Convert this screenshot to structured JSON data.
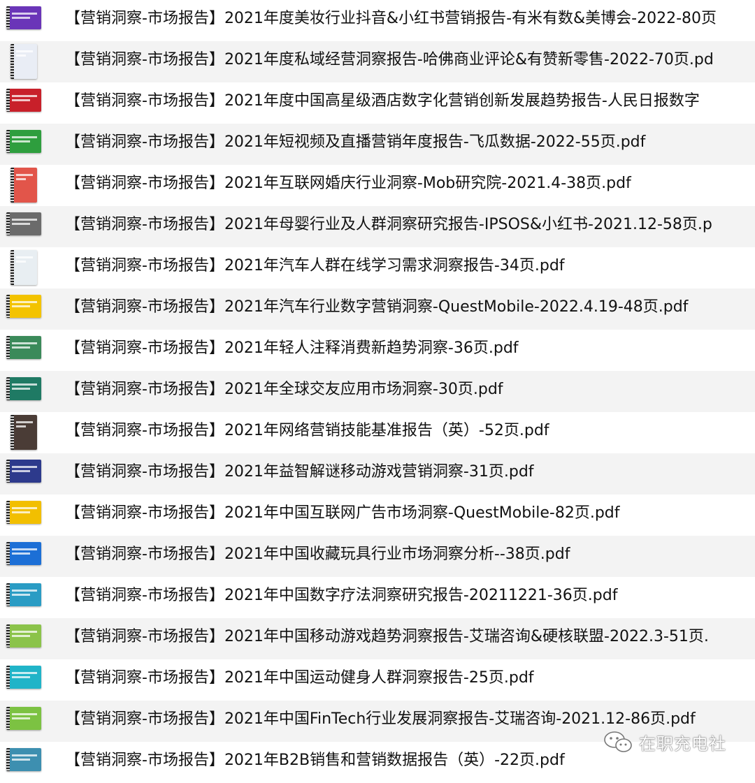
{
  "files": [
    {
      "name": "【营销洞察-市场报告】2021年度美妆行业抖音&小红书营销报告-有米有数&美博会-2022-80页",
      "thumb_color": "#6a35b8"
    },
    {
      "name": "【营销洞察-市场报告】2021年度私域经营洞察报告-哈佛商业评论&有赞新零售-2022-70页.pd",
      "thumb_color": "#e9edf5"
    },
    {
      "name": "【营销洞察-市场报告】2021年度中国高星级酒店数字化营销创新发展趋势报告-人民日报数字",
      "thumb_color": "#c8202a"
    },
    {
      "name": "【营销洞察-市场报告】2021年短视频及直播营销年度报告-飞瓜数据-2022-55页.pdf",
      "thumb_color": "#2e9e3e"
    },
    {
      "name": "【营销洞察-市场报告】2021年互联网婚庆行业洞察-Mob研究院-2021.4-38页.pdf",
      "thumb_color": "#e2554a"
    },
    {
      "name": "【营销洞察-市场报告】2021年母婴行业及人群洞察研究报告-IPSOS&小红书-2021.12-58页.p",
      "thumb_color": "#6b6b6b"
    },
    {
      "name": "【营销洞察-市场报告】2021年汽车人群在线学习需求洞察报告-34页.pdf",
      "thumb_color": "#e8eef2"
    },
    {
      "name": "【营销洞察-市场报告】2021年汽车行业数字营销洞察-QuestMobile-2022.4.19-48页.pdf",
      "thumb_color": "#f3c300"
    },
    {
      "name": "【营销洞察-市场报告】2021年轻人注释消费新趋势洞察-36页.pdf",
      "thumb_color": "#3b8a5a"
    },
    {
      "name": "【营销洞察-市场报告】2021年全球交友应用市场洞察-30页.pdf",
      "thumb_color": "#1f7a64"
    },
    {
      "name": "【营销洞察-市场报告】2021年网络营销技能基准报告（英）-52页.pdf",
      "thumb_color": "#4a3c36"
    },
    {
      "name": "【营销洞察-市场报告】2021年益智解谜移动游戏营销洞察-31页.pdf",
      "thumb_color": "#2d3a8c"
    },
    {
      "name": "【营销洞察-市场报告】2021年中国互联网广告市场洞察-QuestMobile-82页.pdf",
      "thumb_color": "#f2bf00"
    },
    {
      "name": "【营销洞察-市场报告】2021年中国收藏玩具行业市场洞察分析--38页.pdf",
      "thumb_color": "#1c6fd6"
    },
    {
      "name": "【营销洞察-市场报告】2021年中国数字疗法洞察研究报告-20211221-36页.pdf",
      "thumb_color": "#2a9cc4"
    },
    {
      "name": "【营销洞察-市场报告】2021年中国移动游戏趋势洞察报告-艾瑞咨询&硬核联盟-2022.3-51页.",
      "thumb_color": "#8bc34a"
    },
    {
      "name": "【营销洞察-市场报告】2021年中国运动健身人群洞察报告-25页.pdf",
      "thumb_color": "#20b4c8"
    },
    {
      "name": "【营销洞察-市场报告】2021年中国FinTech行业发展洞察报告-艾瑞咨询-2021.12-86页.pdf",
      "thumb_color": "#7cc242"
    },
    {
      "name": "【营销洞察-市场报告】2021年B2B销售和营销数据报告（英）-22页.pdf",
      "thumb_color": "#3d8fb0"
    }
  ],
  "watermark": {
    "text": "在职充电社",
    "icon": "wechat-icon"
  }
}
